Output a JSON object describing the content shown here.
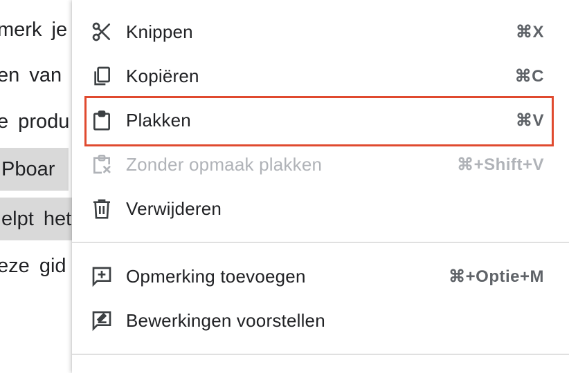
{
  "document": {
    "lines": [
      "merk je",
      "en van",
      "e produ",
      "Pboar",
      "elpt het",
      "eze gid"
    ]
  },
  "menu": {
    "items": [
      {
        "label": "Knippen",
        "shortcut": "⌘X"
      },
      {
        "label": "Kopiëren",
        "shortcut": "⌘C"
      },
      {
        "label": "Plakken",
        "shortcut": "⌘V"
      },
      {
        "label": "Zonder opmaak plakken",
        "shortcut": "⌘+Shift+V"
      },
      {
        "label": "Verwijderen",
        "shortcut": ""
      },
      {
        "label": "Opmerking toevoegen",
        "shortcut": "⌘+Optie+M"
      },
      {
        "label": "Bewerkingen voorstellen",
        "shortcut": ""
      }
    ]
  },
  "colors": {
    "highlight_border": "#e04a2f",
    "text": "#202124",
    "disabled_text": "#b0b3b8",
    "selection_bg": "#d9d9d9"
  }
}
